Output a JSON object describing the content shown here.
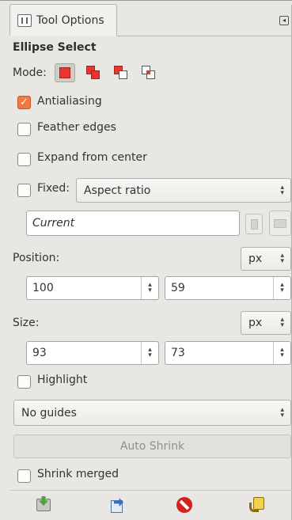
{
  "dock": {
    "tab_label": "Tool Options",
    "menu_glyph": "◂"
  },
  "tool": {
    "title": "Ellipse Select",
    "mode_label": "Mode:",
    "modes": [
      "replace",
      "add",
      "subtract",
      "intersect"
    ],
    "antialiasing": {
      "label": "Antialiasing",
      "checked": true
    },
    "feather": {
      "label": "Feather edges",
      "checked": false
    },
    "expand": {
      "label": "Expand from center",
      "checked": false
    },
    "fixed": {
      "label": "Fixed:",
      "checked": false,
      "value": "Aspect ratio"
    },
    "current_entry": "Current",
    "position": {
      "label": "Position:",
      "unit": "px",
      "x": "100",
      "y": "59"
    },
    "size": {
      "label": "Size:",
      "unit": "px",
      "w": "93",
      "h": "73"
    },
    "highlight": {
      "label": "Highlight",
      "checked": false
    },
    "guides": "No guides",
    "auto_shrink": "Auto Shrink",
    "shrink_merged": {
      "label": "Shrink merged",
      "checked": false
    }
  },
  "footer": {
    "icons": [
      "save-preset-icon",
      "restore-preset-icon",
      "delete-preset-icon",
      "reset-icon"
    ]
  },
  "colors": {
    "accent": "#f07746",
    "selection_red": "#e8352f"
  }
}
